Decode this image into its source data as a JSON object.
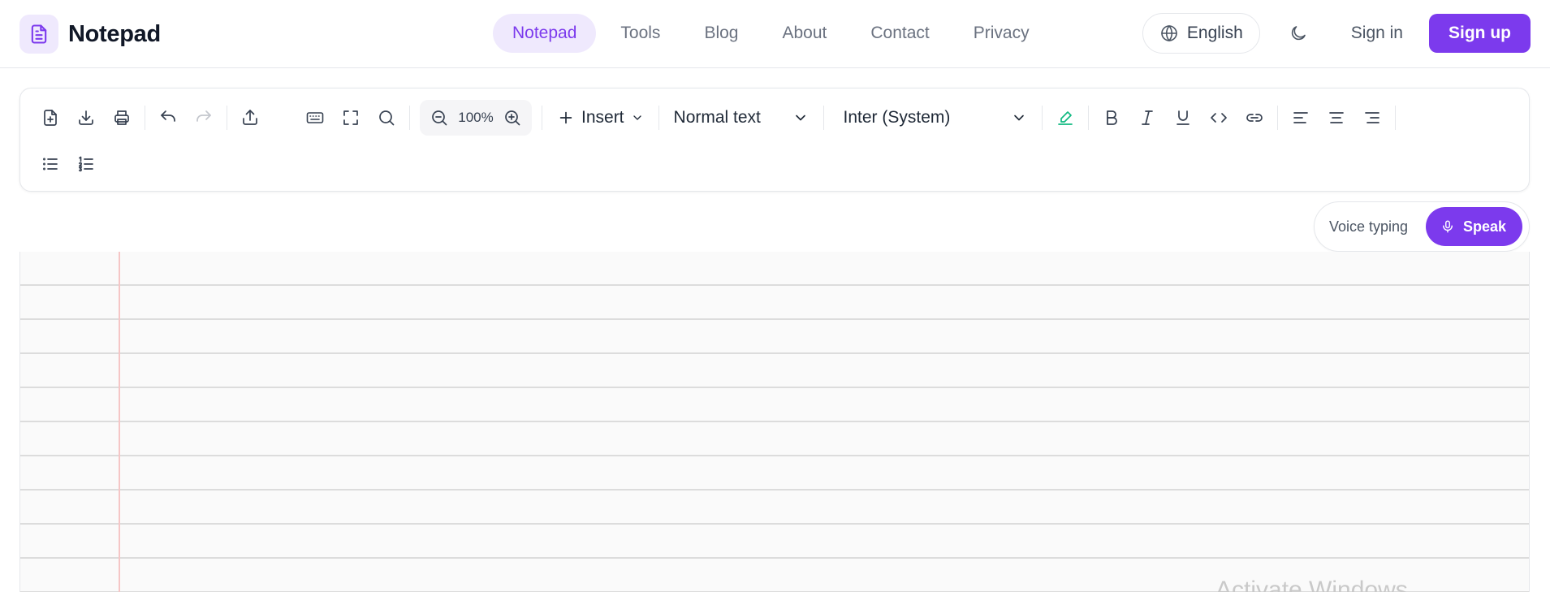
{
  "brand": {
    "name": "Notepad",
    "icon": "notepad-file-icon",
    "accent": "#7c3aed"
  },
  "nav": {
    "items": [
      {
        "label": "Notepad",
        "active": true
      },
      {
        "label": "Tools",
        "active": false
      },
      {
        "label": "Blog",
        "active": false
      },
      {
        "label": "About",
        "active": false
      },
      {
        "label": "Contact",
        "active": false
      },
      {
        "label": "Privacy",
        "active": false
      }
    ]
  },
  "header": {
    "language": "English",
    "sign_in": "Sign in",
    "sign_up": "Sign up"
  },
  "toolbar": {
    "zoom": "100%",
    "insert_label": "Insert",
    "text_style": "Normal text",
    "font_family": "Inter (System)",
    "icons": [
      "new-file-icon",
      "download-icon",
      "print-icon",
      "undo-icon",
      "redo-icon",
      "share-icon",
      "keyboard-icon",
      "fullscreen-icon",
      "search-icon",
      "zoom-out-icon",
      "zoom-in-icon",
      "highlight-icon",
      "bold-icon",
      "italic-icon",
      "underline-icon",
      "code-icon",
      "link-icon",
      "align-left-icon",
      "align-center-icon",
      "align-right-icon",
      "bullet-list-icon",
      "numbered-list-icon"
    ]
  },
  "voice": {
    "label": "Voice typing",
    "button": "Speak"
  },
  "watermark": "Activate Windows"
}
